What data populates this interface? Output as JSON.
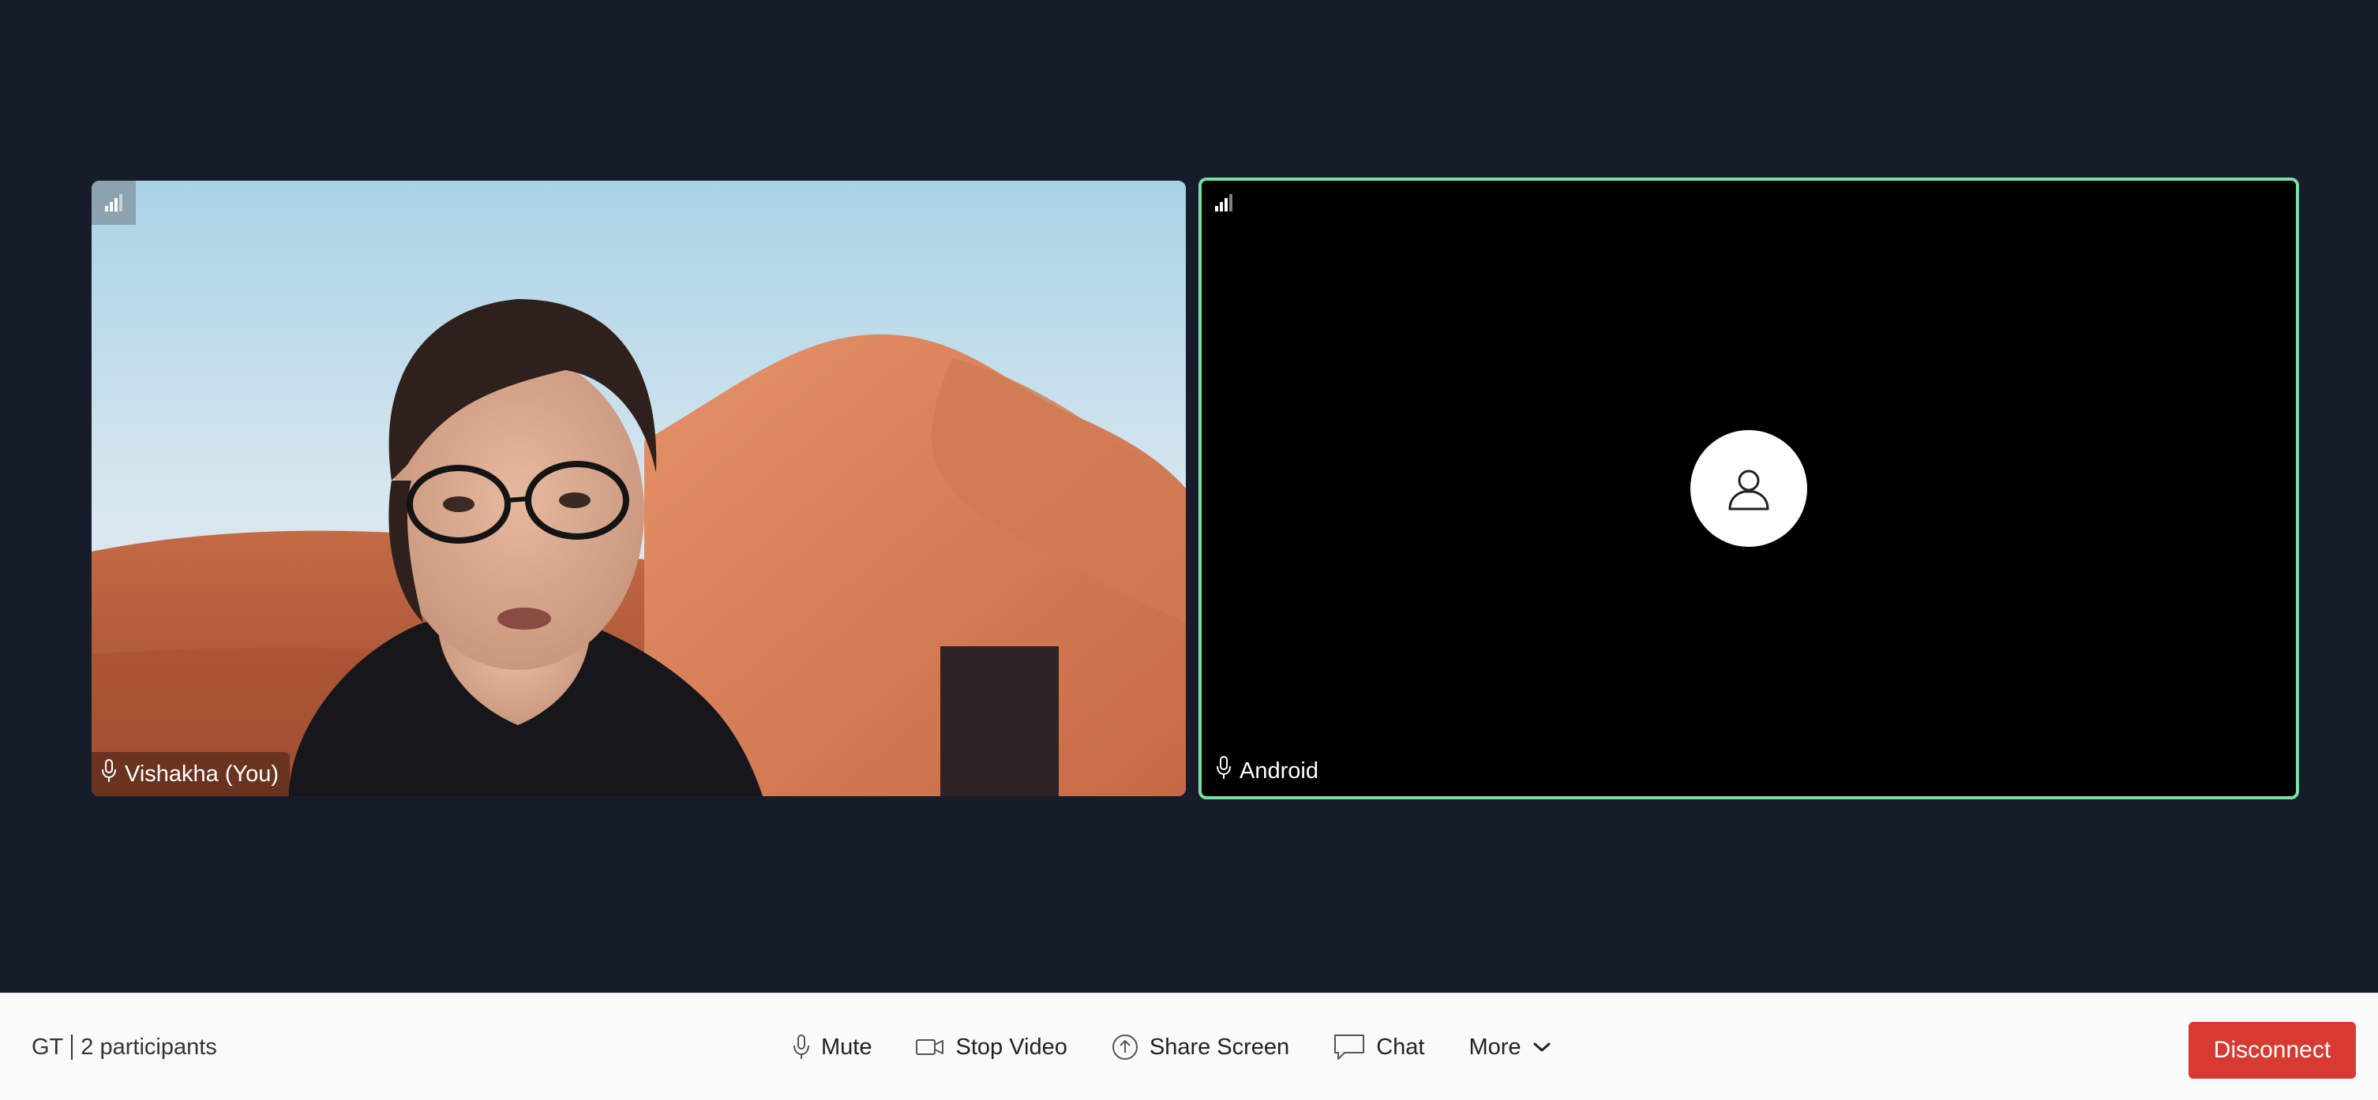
{
  "participants": [
    {
      "name": "Vishakha (You)",
      "role": "local"
    },
    {
      "name": "Android",
      "role": "remote"
    }
  ],
  "room": {
    "code": "GT",
    "participants_label": "2 participants"
  },
  "controls": {
    "mute": "Mute",
    "stop_video": "Stop Video",
    "share_screen": "Share Screen",
    "chat": "Chat",
    "more": "More"
  },
  "disconnect_label": "Disconnect",
  "colors": {
    "background": "#171c2b",
    "active_speaker_border": "#79e0a3",
    "disconnect": "#d63a30",
    "toolbar": "#fafafa"
  },
  "icons": {
    "signal": "signal-strength-icon",
    "mic": "microphone-icon",
    "video": "video-camera-icon",
    "share": "share-screen-icon",
    "chat": "chat-bubble-icon",
    "more": "chevron-down-icon",
    "avatar": "user-avatar-icon"
  }
}
